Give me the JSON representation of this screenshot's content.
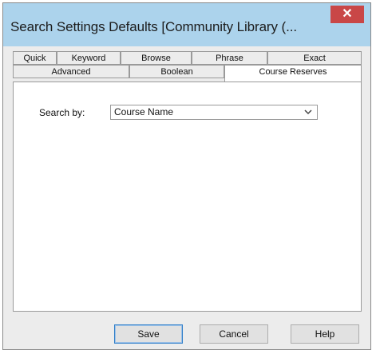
{
  "window": {
    "title": "Search Settings Defaults [Community Library (...",
    "close_symbol": "✕"
  },
  "tabs": {
    "row1": [
      "Quick",
      "Keyword",
      "Browse",
      "Phrase",
      "Exact"
    ],
    "row2": [
      "Advanced",
      "Boolean",
      "Course Reserves"
    ],
    "active": "Course Reserves"
  },
  "form": {
    "search_by_label": "Search by:",
    "search_by_value": "Course Name"
  },
  "buttons": {
    "save": "Save",
    "cancel": "Cancel",
    "help": "Help"
  },
  "icons": {
    "dropdown": "chevron-down-icon",
    "close": "close-icon"
  },
  "colors": {
    "titlebar": "#acd3ec",
    "close": "#c94747",
    "primary_border": "#2f7ec9"
  }
}
